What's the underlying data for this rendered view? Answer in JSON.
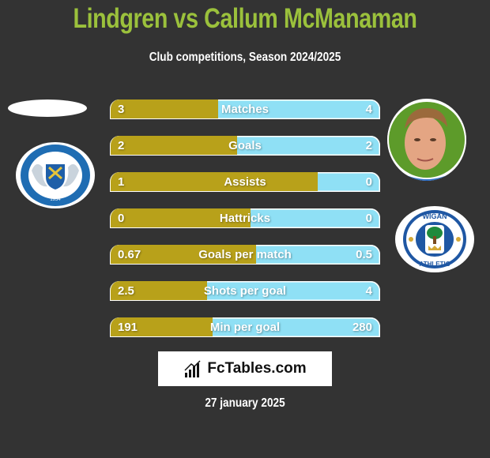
{
  "header": {
    "title": "Lindgren vs Callum McManaman",
    "subtitle": "Club competitions, Season 2024/2025"
  },
  "colors": {
    "left_player": "#b8a11a",
    "right_player": "#8fe0f5",
    "title": "#9bc13c",
    "background": "#333333"
  },
  "left_team": {
    "name": "Peterborough United Football Club",
    "badge_icon": "peterborough-crest-icon"
  },
  "right_team": {
    "name": "Wigan Athletic",
    "badge_icon": "wigan-crest-icon"
  },
  "right_player": {
    "photo_icon": "player-photo"
  },
  "stats": [
    {
      "label": "Matches",
      "left": "3",
      "right": "4",
      "left_share": 0.4
    },
    {
      "label": "Goals",
      "left": "2",
      "right": "2",
      "left_share": 0.47
    },
    {
      "label": "Assists",
      "left": "1",
      "right": "0",
      "left_share": 0.77
    },
    {
      "label": "Hattricks",
      "left": "0",
      "right": "0",
      "left_share": 0.52
    },
    {
      "label": "Goals per match",
      "left": "0.67",
      "right": "0.5",
      "left_share": 0.54
    },
    {
      "label": "Shots per goal",
      "left": "2.5",
      "right": "4",
      "left_share": 0.36
    },
    {
      "label": "Min per goal",
      "left": "191",
      "right": "280",
      "left_share": 0.38
    }
  ],
  "brand": {
    "name": "FcTables.com"
  },
  "footer": {
    "date": "27 january 2025"
  }
}
